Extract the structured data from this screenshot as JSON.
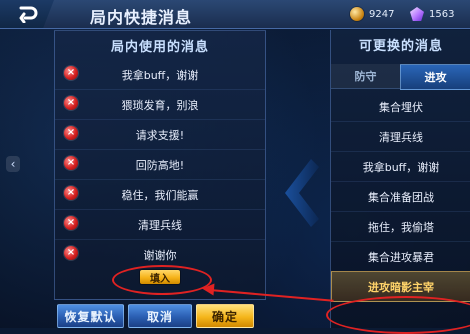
{
  "top_bar": {
    "title": "局内快捷消息",
    "currencies": [
      {
        "icon": "gold-coin-icon",
        "value": "9247"
      },
      {
        "icon": "gem-icon",
        "value": "1563"
      }
    ]
  },
  "left_panel": {
    "title": "局内使用的消息",
    "messages": [
      "我拿buff，谢谢",
      "猥琐发育，别浪",
      "请求支援!",
      "回防高地!",
      "稳住，我们能赢",
      "清理兵线",
      "谢谢你"
    ],
    "fill_button": "填入"
  },
  "bottom_buttons": {
    "restore_default": "恢复默认",
    "cancel": "取消",
    "confirm": "确定"
  },
  "right_panel": {
    "title": "可更换的消息",
    "tabs": [
      "防守",
      "进攻"
    ],
    "active_tab": "进攻",
    "messages": [
      "集合埋伏",
      "清理兵线",
      "我拿buff，谢谢",
      "集合准备团战",
      "拖住，我偷塔",
      "集合进攻暴君",
      "进攻暗影主宰"
    ],
    "selected": "进攻暗影主宰"
  },
  "colors": {
    "accent_blue": "#2a66b8",
    "accent_gold": "#f6b218",
    "annotation_red": "#e02222"
  }
}
